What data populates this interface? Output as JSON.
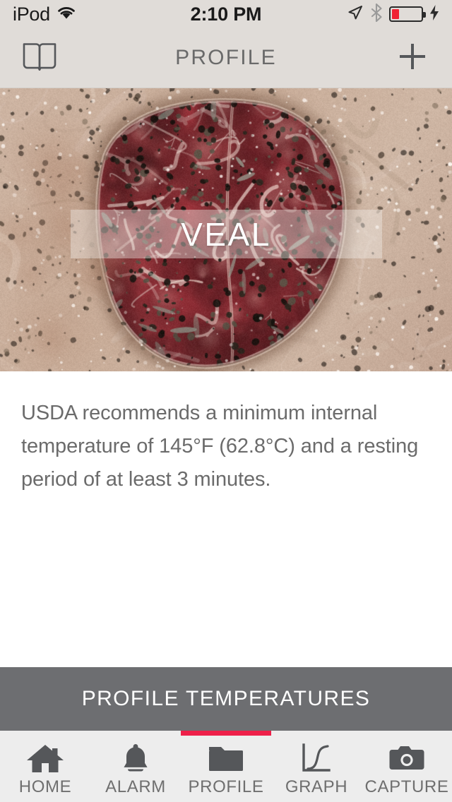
{
  "status_bar": {
    "carrier": "iPod",
    "wifi_icon": "wifi-icon",
    "time": "2:10 PM",
    "location_icon": "location-arrow-icon",
    "bluetooth_icon": "bluetooth-icon",
    "battery_icon": "battery-low-icon",
    "battery_level_percent": 25,
    "battery_color": "#F02233",
    "charging_icon": "lightning-bolt-icon"
  },
  "nav_bar": {
    "left_button_icon": "open-book-icon",
    "title": "PROFILE",
    "right_button_icon": "plus-icon",
    "background": "#E0DCD8"
  },
  "hero": {
    "title": "VEAL",
    "image_description": "raw veal steak on parchment paper with cracked peppercorns and herbs",
    "overlay_color": "rgba(240,235,230,0.42)",
    "title_color": "#FFFFFF"
  },
  "main": {
    "description": "USDA recommends a minimum internal temperature of 145°F (62.8°C) and a resting period of at least 3 minutes.",
    "text_color": "#6B6B6B"
  },
  "section_button": {
    "label": "PROFILE TEMPERATURES",
    "background": "#6D6E71",
    "text_color": "#FFFFFF"
  },
  "tab_bar": {
    "background": "#EDEDED",
    "active_index": 2,
    "active_indicator_color": "#EE2049",
    "label_color": "#6F6F6F",
    "icon_color": "#55575A",
    "items": [
      {
        "label": "HOME",
        "icon": "home-icon"
      },
      {
        "label": "ALARM",
        "icon": "bell-icon"
      },
      {
        "label": "PROFILE",
        "icon": "folder-icon"
      },
      {
        "label": "GRAPH",
        "icon": "line-chart-icon"
      },
      {
        "label": "CAPTURE",
        "icon": "camera-icon"
      }
    ]
  }
}
